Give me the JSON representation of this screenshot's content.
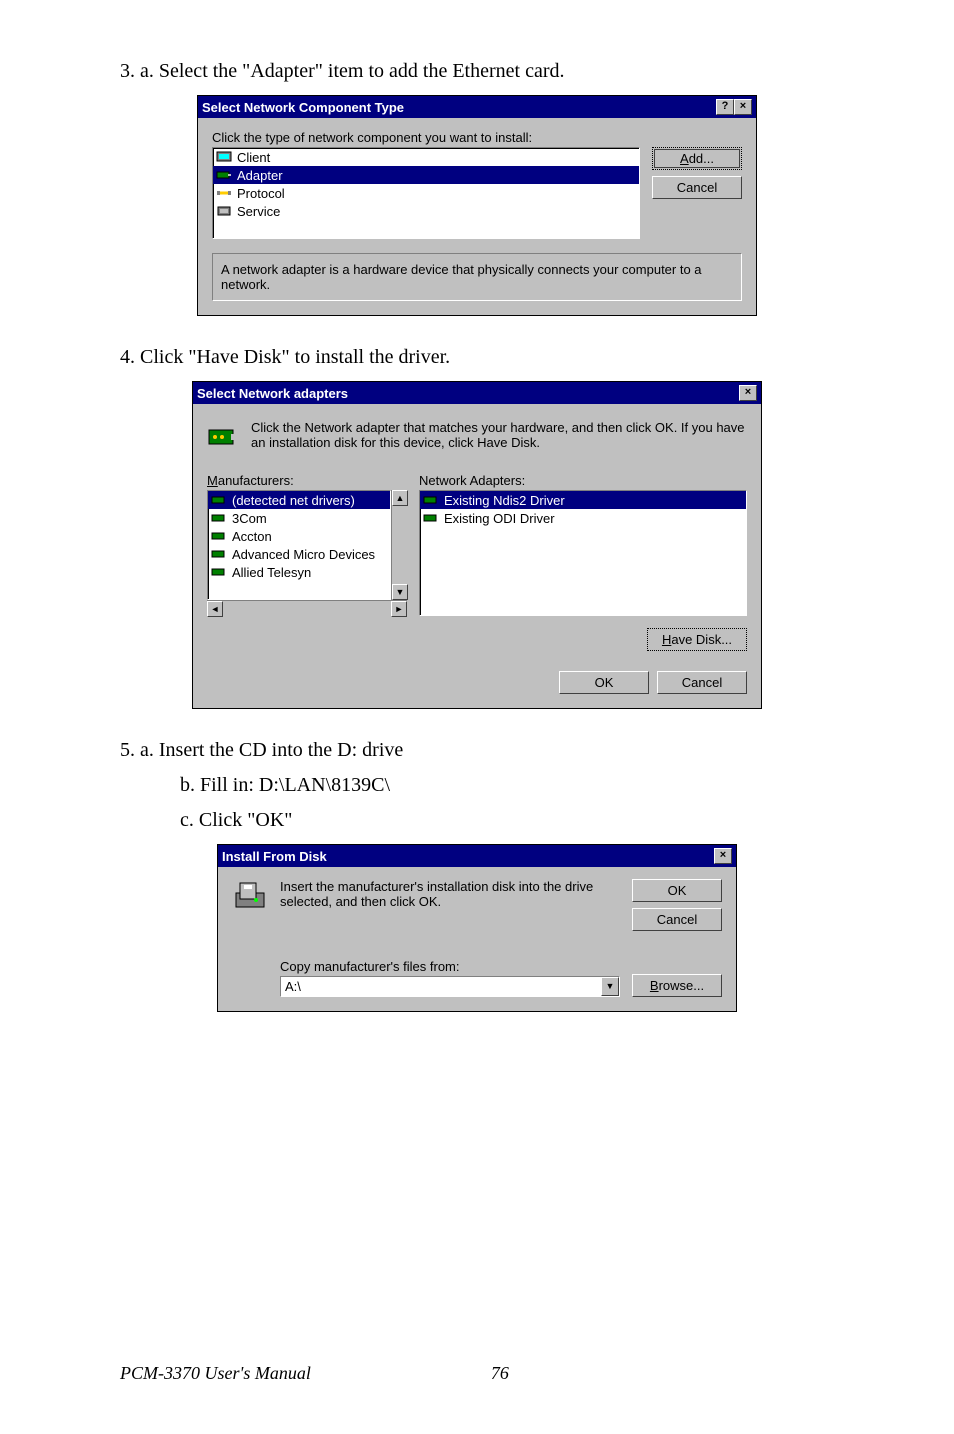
{
  "steps": {
    "s3a": "3. a. Select the \"Adapter\" item to add the Ethernet card.",
    "s4": "4.  Click \"Have Disk\" to install the driver.",
    "s5a": "5.      a. Insert the CD into the D: drive",
    "s5b": "b. Fill in: D:\\LAN\\8139C\\",
    "s5c": "c. Click \"OK\""
  },
  "dialog1": {
    "title": "Select Network Component Type",
    "prompt": "Click the type of network component you want to install:",
    "items": [
      "Client",
      "Adapter",
      "Protocol",
      "Service"
    ],
    "desc": "A network adapter is a hardware device that physically connects your computer to a network.",
    "addBtn": "Add...",
    "cancelBtn": "Cancel"
  },
  "dialog2": {
    "title": "Select Network adapters",
    "desc": "Click the Network adapter that matches your hardware, and then click OK. If you have an installation disk for this device, click Have Disk.",
    "mLabel": "Manufacturers:",
    "nLabel": "Network Adapters:",
    "manufacturers": [
      "(detected net drivers)",
      "3Com",
      "Accton",
      "Advanced Micro Devices",
      "Allied Telesyn"
    ],
    "adapters": [
      "Existing Ndis2 Driver",
      "Existing ODI Driver"
    ],
    "haveDisk": "Have Disk...",
    "ok": "OK",
    "cancel": "Cancel"
  },
  "dialog3": {
    "title": "Install From Disk",
    "desc": "Insert the manufacturer's installation disk into the drive selected, and then click OK.",
    "copyLabel": "Copy manufacturer's files from:",
    "path": "A:\\",
    "ok": "OK",
    "cancel": "Cancel",
    "browse": "Browse..."
  },
  "footer": {
    "left": "PCM-3370 User's Manual",
    "page": "76"
  }
}
